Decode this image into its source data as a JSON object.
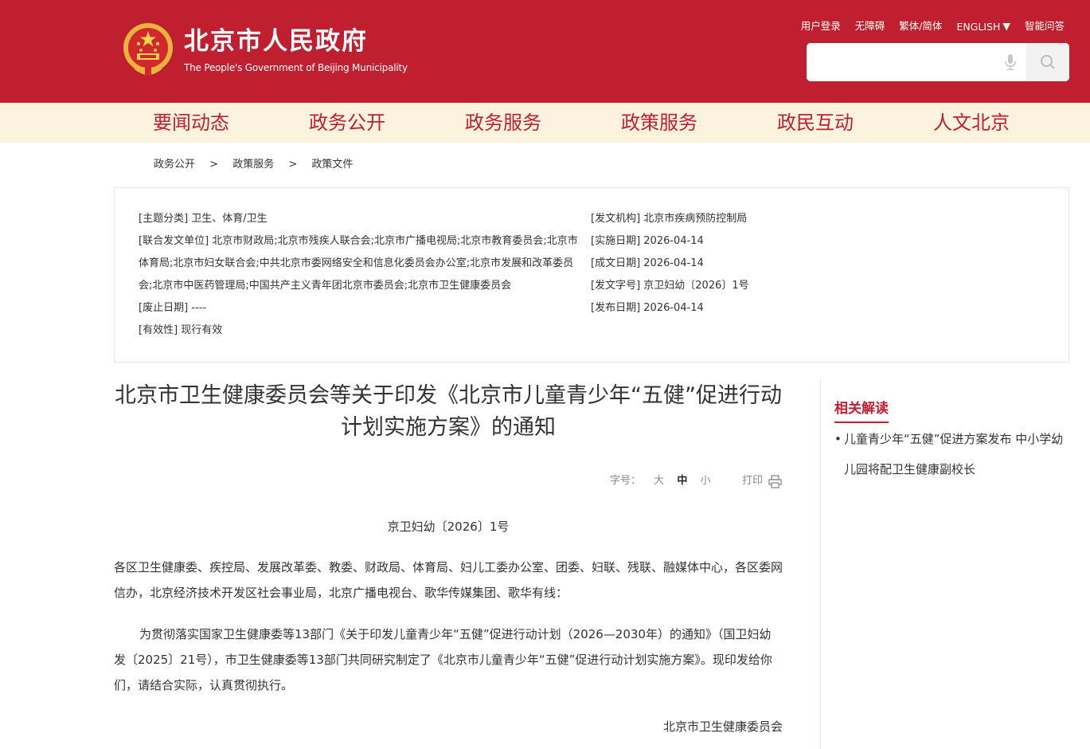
{
  "header": {
    "title": "北京市人民政府",
    "subtitle": "The People's Government of Beijing Municipality",
    "top_links": {
      "login": "用户登录",
      "accessibility": "无障碍",
      "traditional_simplified": "繁体/简体",
      "english": "ENGLISH",
      "smart_qa": "智能问答"
    },
    "search": {
      "value": "",
      "placeholder": ""
    },
    "brand_color": "#bf1f2e"
  },
  "nav": {
    "items": [
      "要闻动态",
      "政务公开",
      "政务服务",
      "政策服务",
      "政民互动",
      "人文北京"
    ],
    "background": "#fcf3df"
  },
  "breadcrumb": {
    "items": [
      "政务公开",
      "政策服务",
      "政策文件"
    ],
    "separator": ">"
  },
  "info": {
    "topic_category": "[主题分类] 卫生、体育/卫生",
    "joint_issuers": "[联合发文单位] 北京市财政局;北京市残疾人联合会;北京市广播电视局;北京市教育委员会;北京市体育局;北京市妇女联合会;中共北京市委网络安全和信息化委员会办公室;北京市发展和改革委员会;北京市中医药管理局;中国共产主义青年团北京市委员会;北京市卫生健康委员会",
    "expiry_date": "[废止日期] ----",
    "validity": "[有效性] 现行有效",
    "issuing_agency": "[发文机构] 北京市疾病预防控制局",
    "effective_date": "[实施日期] 2026-04-14",
    "creation_date": "[成文日期] 2026-04-14",
    "document_number": "[发文字号] 京卫妇幼〔2026〕1号",
    "publish_date": "[发布日期] 2026-04-14"
  },
  "article": {
    "title": "北京市卫生健康委员会等关于印发《北京市儿童青少年“五健”促进行动计划实施方案》的通知",
    "font_size_label": "字号：",
    "font_large": "大",
    "font_medium": "中",
    "font_small": "小",
    "print_label": "打印",
    "doc_number": "京卫妇幼〔2026〕1号",
    "recipients": "各区卫生健康委、疾控局、发展改革委、教委、财政局、体育局、妇儿工委办公室、团委、妇联、残联、融媒体中心，各区委网信办，北京经济技术开发区社会事业局，北京广播电视台、歌华传媒集团、歌华有线：",
    "body": "为贯彻落实国家卫生健康委等13部门《关于印发儿童青少年“五健”促进行动计划（2026—2030年）的通知》（国卫妇幼发〔2025〕21号），市卫生健康委等13部门共同研究制定了《北京市儿童青少年“五健”促进行动计划实施方案》。现印发给你们，请结合实际，认真贯彻执行。",
    "signature": "北京市卫生健康委员会"
  },
  "sidebar": {
    "heading": "相关解读",
    "items": [
      "儿童青少年“五健”促进方案发布 中小学幼儿园将配卫生健康副校长"
    ]
  }
}
